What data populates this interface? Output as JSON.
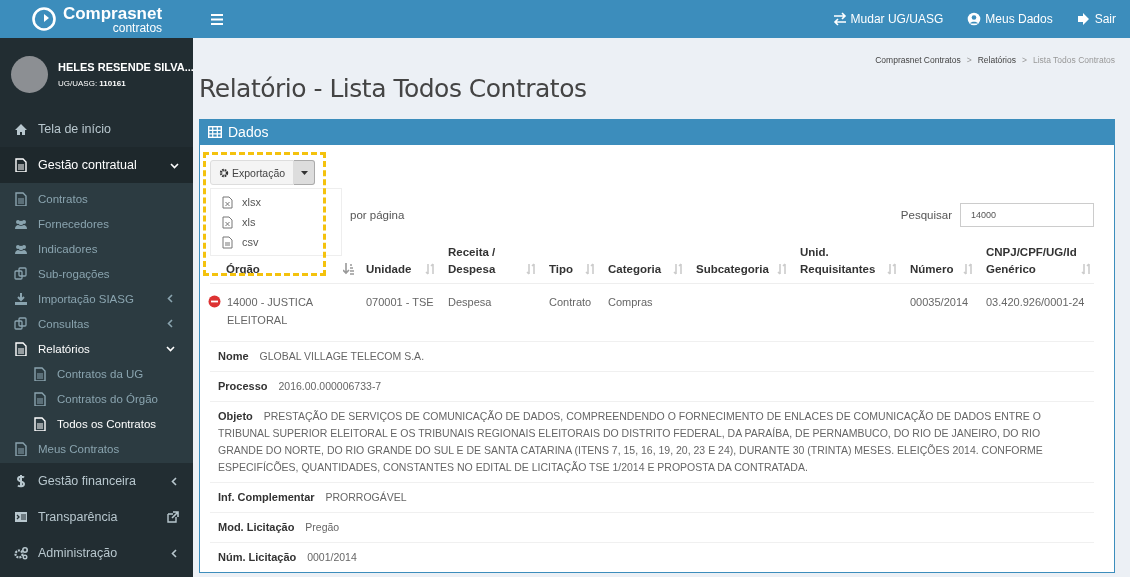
{
  "brand": {
    "name": "Comprasnet",
    "subtitle": "contratos"
  },
  "user": {
    "name": "HELES RESENDE SILVA...",
    "unit_label": "UG/UASG:",
    "unit": "110161"
  },
  "sidebar": {
    "items": [
      {
        "label": "Tela de início",
        "selected": false
      },
      {
        "label": "Gestão contratual",
        "selected": true,
        "expanded": true,
        "children": [
          {
            "label": "Contratos",
            "selected": false
          },
          {
            "label": "Fornecedores",
            "selected": false
          },
          {
            "label": "Indicadores",
            "selected": false
          },
          {
            "label": "Sub-rogações",
            "selected": false
          },
          {
            "label": "Importação SIASG",
            "selected": false,
            "expanded": false
          },
          {
            "label": "Consultas",
            "selected": false,
            "expanded": false
          },
          {
            "label": "Relatórios",
            "selected": true,
            "expanded": true,
            "children": [
              {
                "label": "Contratos da UG",
                "selected": false
              },
              {
                "label": "Contratos do Órgão",
                "selected": false
              },
              {
                "label": "Todos os Contratos",
                "selected": true
              }
            ]
          },
          {
            "label": "Meus Contratos",
            "selected": false
          }
        ]
      },
      {
        "label": "Gestão financeira",
        "selected": false,
        "expanded": false
      },
      {
        "label": "Transparência",
        "selected": false,
        "external": true
      },
      {
        "label": "Administração",
        "selected": false,
        "expanded": false
      }
    ]
  },
  "topbar": {
    "links": [
      "Mudar UG/UASG",
      "Meus Dados",
      "Sair"
    ]
  },
  "breadcrumb": [
    {
      "kind": "link",
      "text": "Comprasnet Contratos"
    },
    {
      "kind": "separator",
      "text": ">"
    },
    {
      "kind": "link",
      "text": "Relatórios"
    },
    {
      "kind": "separator",
      "text": ">"
    },
    {
      "kind": "current",
      "text": "Lista Todos Contratos"
    }
  ],
  "page_title": "Relatório - Lista Todos Contratos",
  "panel": {
    "title": "Dados",
    "export": {
      "label": "Exportação",
      "open": true,
      "highlighted": true,
      "options": [
        "xlsx",
        "xls",
        "csv"
      ]
    },
    "page_length_suffix": "por página",
    "search": {
      "label": "Pesquisar",
      "value": "14000"
    },
    "table": {
      "columns": [
        {
          "label": "Órgão",
          "sorted": true
        },
        {
          "label": "Unidade",
          "sorted": false
        },
        {
          "label": "Receita / Despesa",
          "sorted": false
        },
        {
          "label": "Tipo",
          "sorted": false
        },
        {
          "label": "Categoria",
          "sorted": false
        },
        {
          "label": "Subcategoria",
          "sorted": false
        },
        {
          "label": "Unid. Requisitantes",
          "sorted": false
        },
        {
          "label": "Número",
          "sorted": false
        },
        {
          "label": "CNPJ/CPF/UG/Id Genérico",
          "sorted": false
        }
      ],
      "rows": [
        {
          "expanded": true,
          "cells": [
            "14000 - JUSTICA ELEITORAL",
            "070001 - TSE",
            "Despesa",
            "Contrato",
            "Compras",
            "",
            "",
            "00035/2014",
            "03.420.926/0001-24"
          ],
          "details": [
            {
              "label": "Nome",
              "value": "GLOBAL VILLAGE TELECOM S.A."
            },
            {
              "label": "Processo",
              "value": "2016.00.000006733-7"
            },
            {
              "label": "Objeto",
              "value": "PRESTAÇÃO DE SERVIÇOS DE COMUNICAÇÃO DE DADOS, COMPREENDENDO O FORNECIMENTO DE ENLACES DE COMUNICAÇÃO DE DADOS ENTRE O TRIBUNAL SUPERIOR ELEITORAL E OS TRIBUNAIS REGIONAIS ELEITORAIS DO DISTRITO FEDERAL, DA PARAÍBA, DE PERNAMBUCO, DO RIO DE JANEIRO, DO RIO GRANDE DO NORTE, DO RIO GRANDE DO SUL E DE SANTA CATARINA (ITENS 7, 15, 16, 19, 20, 23 E 24), DURANTE 30 (TRINTA) MESES. ELEIÇÕES 2014. CONFORME ESPECIFÍCÕES, QUANTIDADES, CONSTANTES NO EDITAL DE LICITAÇÃO TSE 1/2014 E PROPOSTA DA CONTRATADA."
            },
            {
              "label": "Inf. Complementar",
              "value": "PRORROGÁVEL"
            },
            {
              "label": "Mod. Licitação",
              "value": "Pregão"
            },
            {
              "label": "Núm. Licitação",
              "value": "0001/2014"
            }
          ]
        }
      ]
    }
  }
}
